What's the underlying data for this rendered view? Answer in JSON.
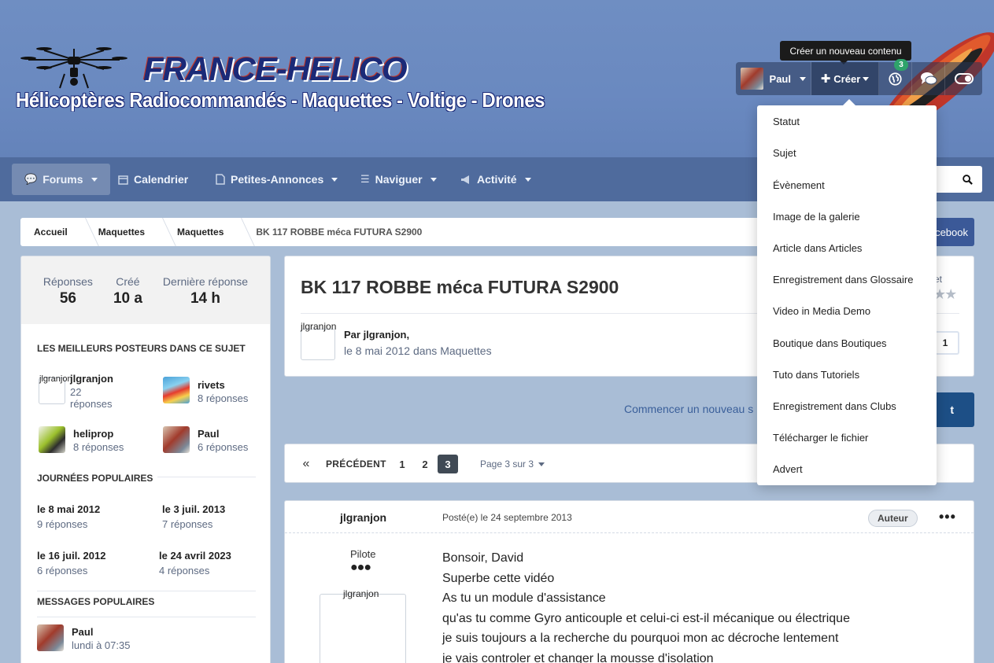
{
  "header": {
    "brand": "FRANCE-HELICO",
    "tagline": "Hélicoptères Radiocommandés - Maquettes - Voltige - Drones"
  },
  "userbar": {
    "username": "Paul",
    "create_label": "Créer",
    "notifications_count": "3",
    "tooltip": "Créer un nouveau contenu"
  },
  "nav": {
    "items": [
      {
        "label": "Forums",
        "icon": "comments-icon"
      },
      {
        "label": "Calendrier",
        "icon": "calendar-icon"
      },
      {
        "label": "Petites-Annonces",
        "icon": "document-icon"
      },
      {
        "label": "Naviguer",
        "icon": "list-icon"
      },
      {
        "label": "Activité",
        "icon": "megaphone-icon"
      }
    ]
  },
  "breadcrumb": {
    "items": [
      "Accueil",
      "Maquettes",
      "Maquettes",
      "BK 117 ROBBE méca FUTURA S2900"
    ]
  },
  "facebook_label": "acebook",
  "sidebar": {
    "stats": [
      {
        "label": "Réponses",
        "value": "56"
      },
      {
        "label": "Créé",
        "value": "10 a"
      },
      {
        "label": "Dernière réponse",
        "value": "14 h"
      }
    ],
    "top_posters_heading": "Les meilleurs posteurs dans ce sujet",
    "top_posters": [
      {
        "name": "jlgranjon",
        "replies": "22 réponses",
        "avatar_alt": "jlgranjon"
      },
      {
        "name": "rivets",
        "replies": "8 réponses"
      },
      {
        "name": "heliprop",
        "replies": "8 réponses"
      },
      {
        "name": "Paul",
        "replies": "6 réponses"
      }
    ],
    "popular_days_heading": "Journées populaires",
    "popular_days": [
      {
        "date": "le 8 mai 2012",
        "replies": "9 réponses"
      },
      {
        "date": "le 3 juil. 2013",
        "replies": "7 réponses"
      },
      {
        "date": "le 16 juil. 2012",
        "replies": "6 réponses"
      },
      {
        "date": "le 24 avril 2023",
        "replies": "4 réponses"
      }
    ],
    "popular_posts_heading": "Messages populaires",
    "popular_post": {
      "name": "Paul",
      "date": "lundi à 07:35"
    }
  },
  "topic": {
    "title": "BK 117 ROBBE méca FUTURA S2900",
    "avatar_alt": "jlgranjon",
    "author": "Par jlgranjon,",
    "date": "le 8 mai 2012 dans Maquettes",
    "rating_label": "et",
    "stars": "★★",
    "follow_count": "1"
  },
  "new_topic_link": "Commencer un nouveau s",
  "reply_label": "t",
  "pagination": {
    "first": "«",
    "prev": "PRÉCÉDENT",
    "pages": [
      "1",
      "2",
      "3"
    ],
    "current": "3",
    "info": "Page 3 sur 3"
  },
  "post": {
    "author": "jlgranjon",
    "date": "Posté(e) le 24 septembre 2013",
    "badge": "Auteur",
    "menu": "•••",
    "rank": "Pilote",
    "pips": "●●●",
    "avatar_alt": "jlgranjon",
    "lines": [
      "Bonsoir, David",
      "Superbe cette vidéo",
      "As tu un module d'assistance",
      "qu'as tu comme Gyro anticouple et celui-ci est-il mécanique ou électrique",
      "je suis toujours a la recherche du pourquoi mon ac décroche lentement",
      "je vais controler et changer la mousse d'isolation"
    ]
  },
  "create_menu": {
    "items": [
      "Statut",
      "Sujet",
      "Évènement",
      "Image de la galerie",
      "Article dans Articles",
      "Enregistrement dans Glossaire",
      "Video in Media Demo",
      "Boutique dans Boutiques",
      "Tuto dans Tutoriels",
      "Enregistrement dans Clubs",
      "Télécharger le fichier",
      "Advert"
    ]
  },
  "colors": {
    "header_bg": "#6f8ec2",
    "nav_bg": "#4f6b9d",
    "body_bg": "#a9bdd6",
    "primary_button": "#1d4f86",
    "facebook": "#3b5998",
    "badge_green": "#2fa36b"
  }
}
